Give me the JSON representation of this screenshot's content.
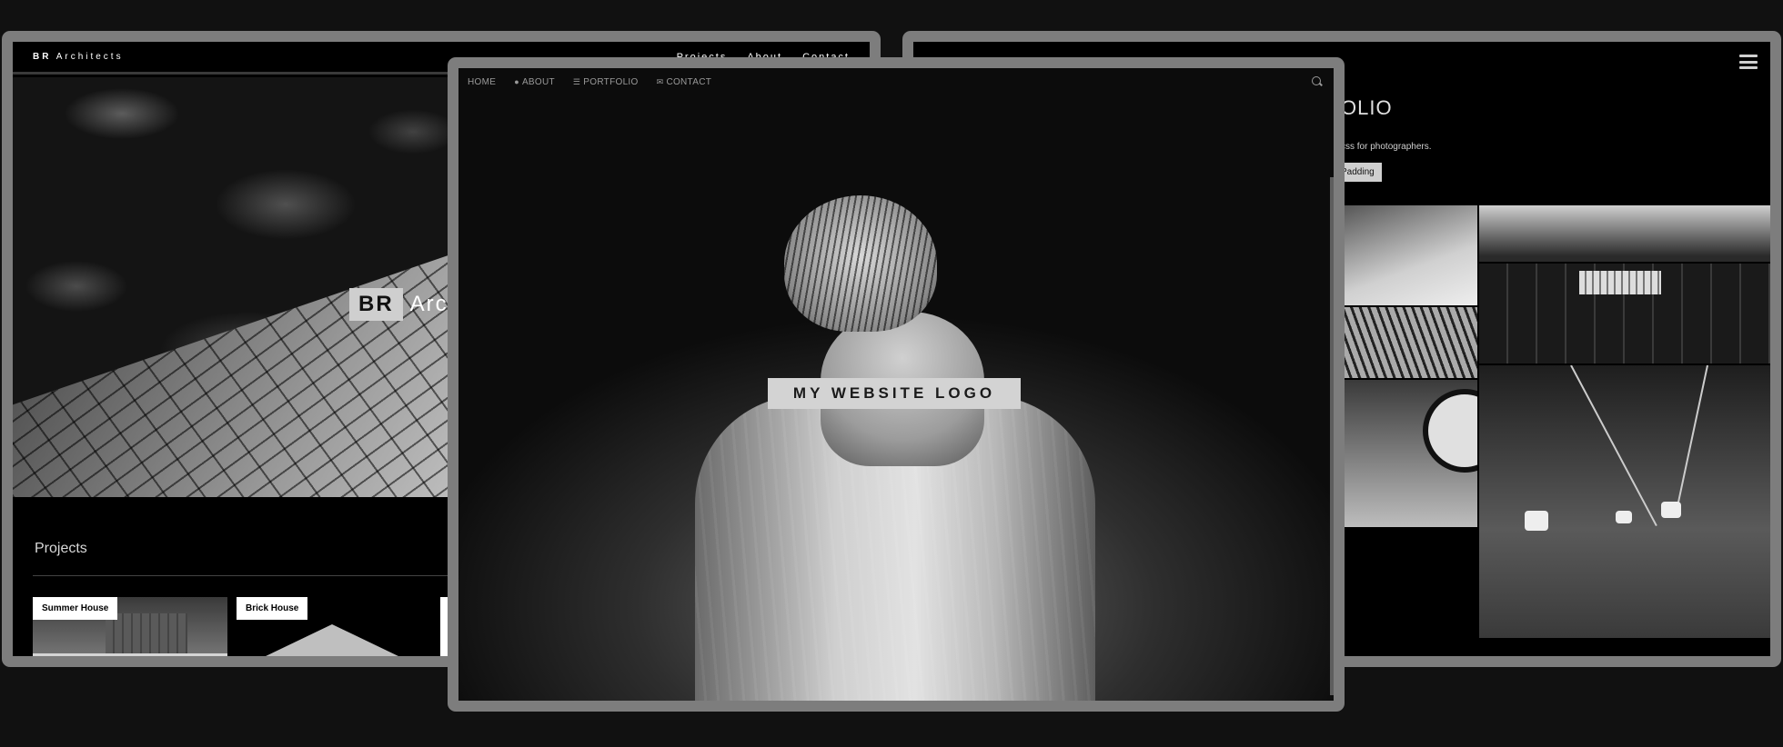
{
  "left_site": {
    "brand_bold": "BR",
    "brand_rest": "Architects",
    "nav": [
      "Projects",
      "About",
      "Contact"
    ],
    "hero_logo_box": "BR",
    "hero_logo_text": "Arc",
    "section_title": "Projects",
    "projects": [
      "Summer House",
      "Brick House"
    ]
  },
  "center_site": {
    "nav": [
      {
        "label": "HOME",
        "icon": ""
      },
      {
        "label": "ABOUT",
        "icon": "user-icon"
      },
      {
        "label": "PORTFOLIO",
        "icon": "th-list-icon"
      },
      {
        "label": "CONTACT",
        "icon": "envelope-icon"
      }
    ],
    "logo": "MY WEBSITE LOGO"
  },
  "right_site": {
    "title_visible": "OLIO",
    "description_visible": "css for photographers.",
    "button_label": "Padding"
  }
}
